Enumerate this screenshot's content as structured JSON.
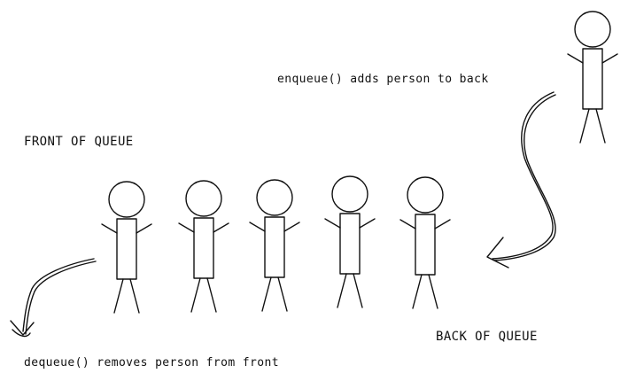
{
  "labels": {
    "front": "FRONT OF QUEUE",
    "back": "BACK OF QUEUE",
    "enqueue": "enqueue() adds person to back",
    "dequeue": "dequeue() removes person from front"
  },
  "queue": {
    "people_in_queue": 5,
    "incoming_people": 1
  },
  "colors": {
    "ink": "#111111",
    "background": "#ffffff"
  }
}
